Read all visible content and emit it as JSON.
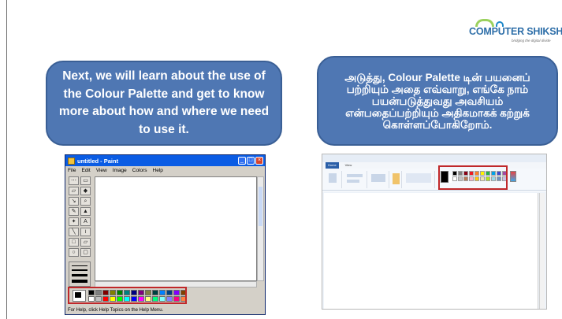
{
  "logo": {
    "name": "COMPUTER SHIKSHA",
    "tagline": "bridging the digital divide"
  },
  "english_bubble": {
    "text": "Next, we will learn about the use of the Colour Palette and get to know more about how and where we need to use it."
  },
  "tamil_bubble": {
    "text": "அடுத்து, Colour Palette டின் பயனைப் பற்றியும் அதை எவ்வாறு, எங்கே நாம் பயன்படுத்துவது அவசியம் என்பதைப்பற்றியும் அதிகமாகக் கற்றுக் கொள்ளப்போகிறோம்."
  },
  "classic_paint": {
    "title": "untitled - Paint",
    "menu": [
      "File",
      "Edit",
      "View",
      "Image",
      "Colors",
      "Help"
    ],
    "status": "For Help, click Help Topics on the Help Menu.",
    "palette_colors": [
      "#000000",
      "#808080",
      "#800000",
      "#808000",
      "#008000",
      "#008080",
      "#000080",
      "#800080",
      "#808040",
      "#004040",
      "#0080ff",
      "#004080",
      "#8000ff",
      "#804000",
      "#ffffff",
      "#c0c0c0",
      "#ff0000",
      "#ffff00",
      "#00ff00",
      "#00ffff",
      "#0000ff",
      "#ff00ff",
      "#ffff80",
      "#00ff80",
      "#80ffff",
      "#8080ff",
      "#ff0080",
      "#ff8040"
    ]
  },
  "ribbon_paint": {
    "tabs": [
      "Home",
      "View"
    ],
    "palette_colors": [
      "#000000",
      "#7f7f7f",
      "#880015",
      "#ed1c24",
      "#ff7f27",
      "#fff200",
      "#22b14c",
      "#00a2e8",
      "#3f48cc",
      "#a349a4",
      "#ffffff",
      "#c3c3c3",
      "#b97a57",
      "#ffaec9",
      "#ffc90e",
      "#efe4b0",
      "#b5e61d",
      "#99d9ea",
      "#7092be",
      "#c8bfe7"
    ]
  },
  "colors": {
    "bubble_fill": "#4f77b3",
    "highlight_box": "#c0282a"
  }
}
